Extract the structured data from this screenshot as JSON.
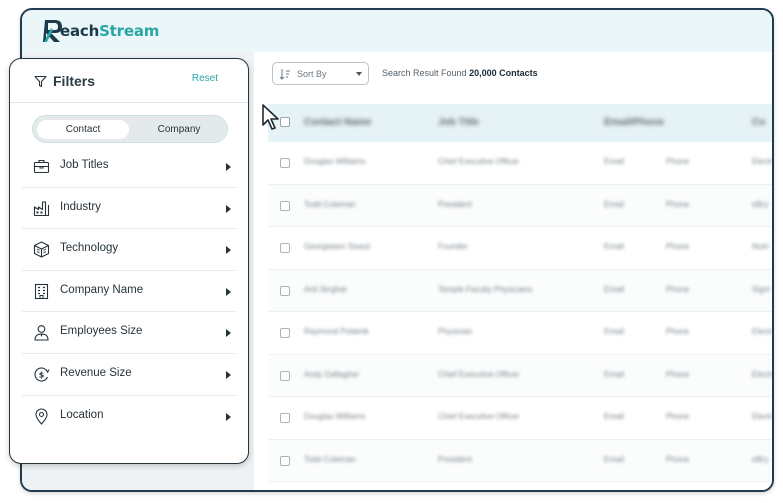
{
  "app": {
    "logo_initial": "R",
    "logo_rest": "each",
    "logo_accent": "Stream",
    "brand_color": "#2aa6a6"
  },
  "toolbar": {
    "sort_label": "Sort By",
    "result_prefix": "Search Result Found",
    "result_count": "20,000 Contacts"
  },
  "table": {
    "headers": [
      "Contact Name",
      "Job Title",
      "Email/Phone",
      "Co"
    ],
    "rows": [
      {
        "name": "Douglas Williams",
        "title": "Chief Executive Officer",
        "email": "Email",
        "phone": "Phone",
        "company": "Electr"
      },
      {
        "name": "Todd Coleman",
        "title": "President",
        "email": "Email",
        "phone": "Phone",
        "company": "eBry"
      },
      {
        "name": "Georgiaann Swaol",
        "title": "Founder",
        "email": "Email",
        "phone": "Phone",
        "company": "Nutri"
      },
      {
        "name": "Anil Singhal",
        "title": "Temple Faculty Physicians",
        "email": "Email",
        "phone": "Phone",
        "company": "Signi"
      },
      {
        "name": "Raymond Polatnik",
        "title": "Physician",
        "email": "Email",
        "phone": "Phone",
        "company": "Electr"
      },
      {
        "name": "Andy Gallagher",
        "title": "Chief Executive Officer",
        "email": "Email",
        "phone": "Phone",
        "company": "Electr"
      },
      {
        "name": "Douglas Williams",
        "title": "Chief Executive Officer",
        "email": "Email",
        "phone": "Phone",
        "company": "Electr"
      },
      {
        "name": "Todd Coleman",
        "title": "President",
        "email": "Email",
        "phone": "Phone",
        "company": "eBry"
      }
    ]
  },
  "filters": {
    "title": "Filters",
    "reset_label": "Reset",
    "toggle": {
      "active": "Contact",
      "inactive": "Company"
    },
    "items": [
      {
        "label": "Job Titles",
        "icon": "briefcase-icon"
      },
      {
        "label": "Industry",
        "icon": "factory-icon"
      },
      {
        "label": "Technology",
        "icon": "cube-icon"
      },
      {
        "label": "Company Name",
        "icon": "building-icon"
      },
      {
        "label": "Employees Size",
        "icon": "employee-icon"
      },
      {
        "label": "Revenue Size",
        "icon": "revenue-icon"
      },
      {
        "label": "Location",
        "icon": "location-pin-icon"
      }
    ]
  }
}
